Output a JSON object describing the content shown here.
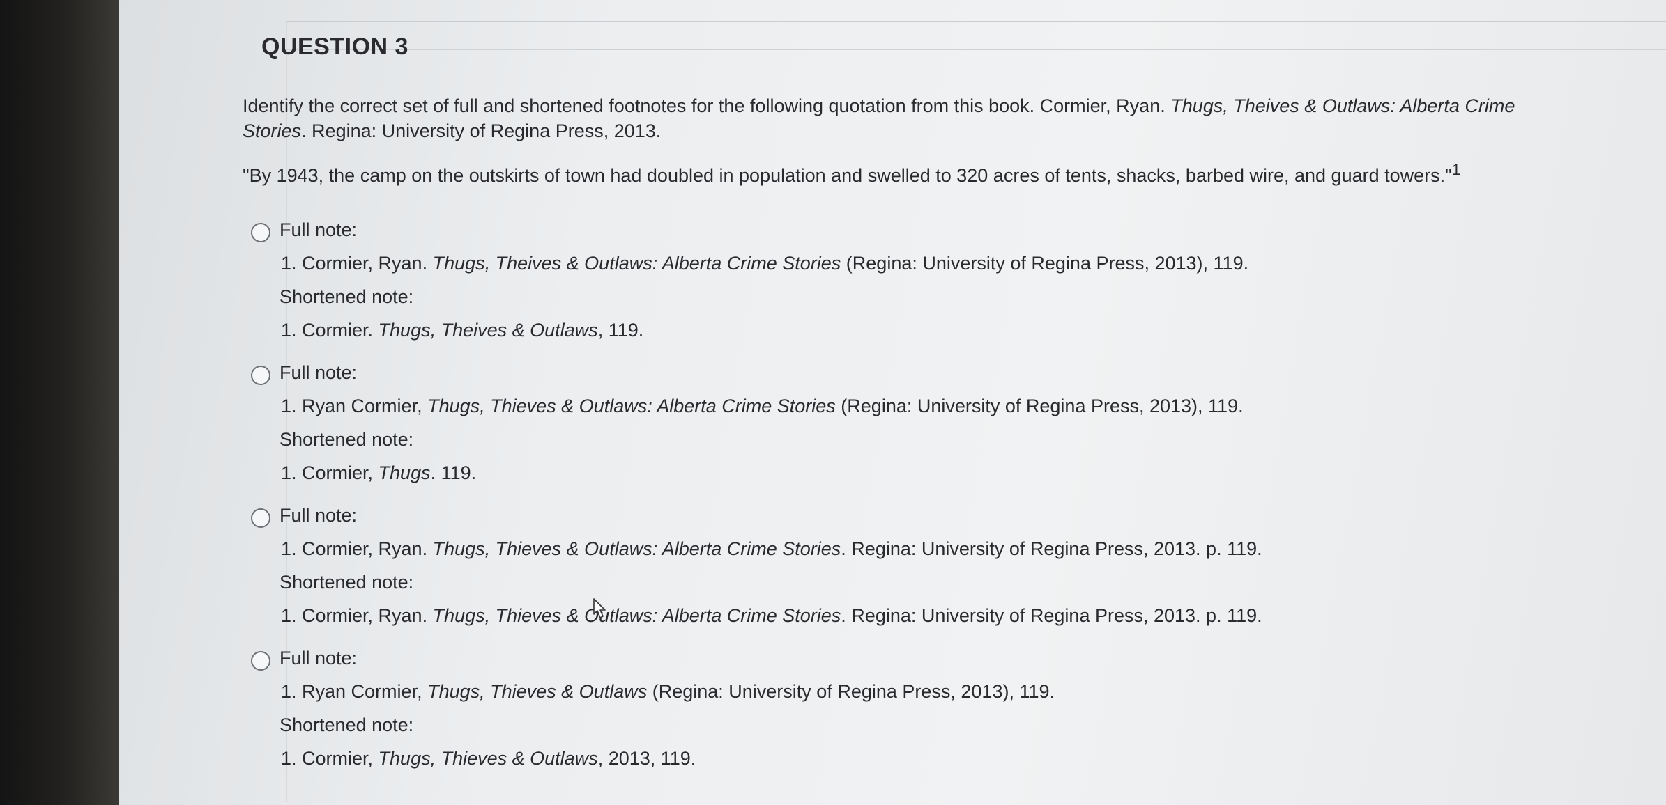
{
  "question": {
    "title": "QUESTION 3",
    "prompt": {
      "intro": "Identify the correct set of full and shortened footnotes for the following quotation from this book. Cormier, Ryan. ",
      "book_title": "Thugs, Theives & Outlaws: Alberta Crime Stories",
      "tail": ". Regina: University of Regina Press, 2013."
    },
    "quote": "\"By 1943, the camp on the outskirts of town had doubled in population and swelled to 320 acres of tents, shacks, barbed wire, and guard towers.\"",
    "quote_marker": "1"
  },
  "options": [
    {
      "full_label": "Full note:",
      "full_a": "1. Cormier, Ryan. ",
      "full_i": "Thugs, Theives & Outlaws: Alberta Crime Stories",
      "full_b": " (Regina: University of Regina Press, 2013), 119.",
      "short_label": "Shortened note:",
      "short_a": "1. Cormier. ",
      "short_i": "Thugs, Theives & Outlaws",
      "short_b": ", 119."
    },
    {
      "full_label": "Full note:",
      "full_a": "1.  Ryan Cormier, ",
      "full_i": "Thugs, Thieves & Outlaws: Alberta Crime Stories",
      "full_b": " (Regina: University of Regina Press, 2013), 119.",
      "short_label": "Shortened note:",
      "short_a": "1. Cormier, ",
      "short_i": "Thugs",
      "short_b": ". 119."
    },
    {
      "full_label": "Full note:",
      "full_a": "1.  Cormier, Ryan. ",
      "full_i": "Thugs, Thieves & Outlaws: Alberta Crime Stories",
      "full_b": ". Regina: University of Regina Press, 2013. p. 119.",
      "short_label": "Shortened note:",
      "short_a": "1. Cormier, Ryan. ",
      "short_i": "Thugs, Thieves & Outlaws: Alberta Crime Stories",
      "short_b": ". Regina: University of Regina Press, 2013. p. 119."
    },
    {
      "full_label": "Full note:",
      "full_a": "1. Ryan Cormier, ",
      "full_i": "Thugs, Thieves & Outlaws",
      "full_b": " (Regina: University of Regina Press, 2013), 119.",
      "short_label": "Shortened note:",
      "short_a": "1. Cormier, ",
      "short_i": "Thugs, Thieves & Outlaws",
      "short_b": ", 2013, 119."
    }
  ]
}
